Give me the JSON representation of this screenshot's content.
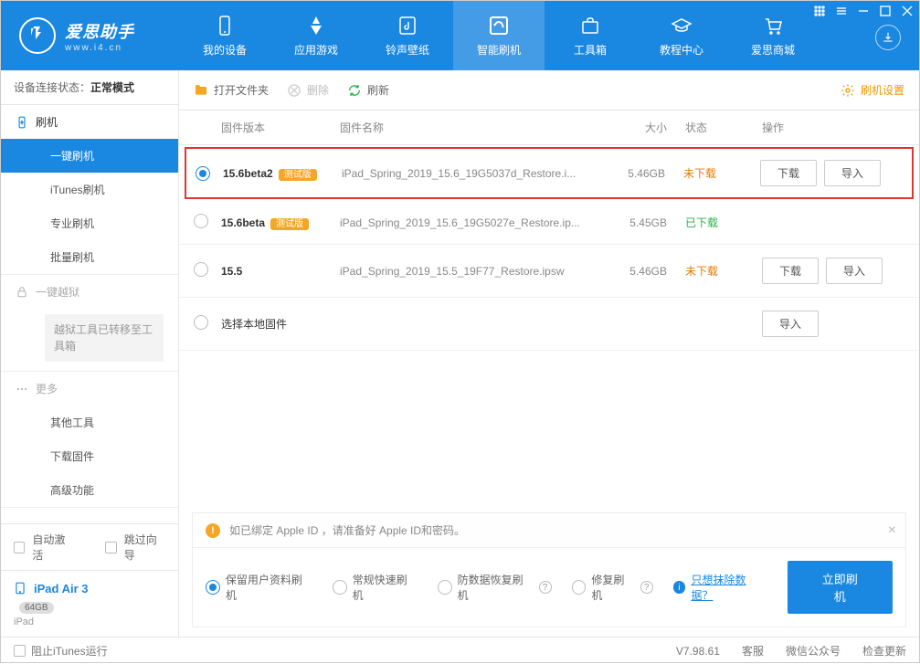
{
  "app": {
    "title": "爱思助手",
    "url": "www.i4.cn"
  },
  "nav": [
    {
      "label": "我的设备"
    },
    {
      "label": "应用游戏"
    },
    {
      "label": "铃声壁纸"
    },
    {
      "label": "智能刷机"
    },
    {
      "label": "工具箱"
    },
    {
      "label": "教程中心"
    },
    {
      "label": "爱思商城"
    }
  ],
  "sidebar": {
    "status_label": "设备连接状态：",
    "status_value": "正常模式",
    "flash_header": "刷机",
    "items": [
      "一键刷机",
      "iTunes刷机",
      "专业刷机",
      "批量刷机"
    ],
    "jailbreak": "一键越狱",
    "jailbreak_note": "越狱工具已转移至工具箱",
    "more_header": "更多",
    "more_items": [
      "其他工具",
      "下载固件",
      "高级功能"
    ],
    "auto_activate": "自动激活",
    "skip_guide": "跳过向导",
    "device_name": "iPad Air 3",
    "device_storage": "64GB",
    "device_type": "iPad"
  },
  "toolbar": {
    "open": "打开文件夹",
    "delete": "删除",
    "refresh": "刷新",
    "settings": "刷机设置"
  },
  "table": {
    "headers": {
      "version": "固件版本",
      "name": "固件名称",
      "size": "大小",
      "status": "状态",
      "action": "操作"
    },
    "rows": [
      {
        "selected": true,
        "version": "15.6beta2",
        "badge": "测试版",
        "name": "iPad_Spring_2019_15.6_19G5037d_Restore.i...",
        "size": "5.46GB",
        "status": "未下载",
        "status_class": "st-red",
        "download": "下载",
        "import": "导入",
        "highlight": true
      },
      {
        "selected": false,
        "version": "15.6beta",
        "badge": "测试版",
        "name": "iPad_Spring_2019_15.6_19G5027e_Restore.ip...",
        "size": "5.45GB",
        "status": "已下载",
        "status_class": "st-green"
      },
      {
        "selected": false,
        "version": "15.5",
        "badge": "",
        "name": "iPad_Spring_2019_15.5_19F77_Restore.ipsw",
        "size": "5.46GB",
        "status": "未下载",
        "status_class": "st-red",
        "download": "下载",
        "import": "导入"
      }
    ],
    "local_label": "选择本地固件",
    "local_import": "导入"
  },
  "alert": "如已绑定 Apple ID ，请准备好 Apple ID和密码。",
  "flash_options": {
    "opt1": "保留用户资料刷机",
    "opt2": "常规快速刷机",
    "opt3": "防数据恢复刷机",
    "opt4": "修复刷机",
    "erase_link": "只想抹除数据？",
    "flash_btn": "立即刷机"
  },
  "footer": {
    "block_itunes": "阻止iTunes运行",
    "version": "V7.98.61",
    "service": "客服",
    "wechat": "微信公众号",
    "update": "检查更新"
  }
}
